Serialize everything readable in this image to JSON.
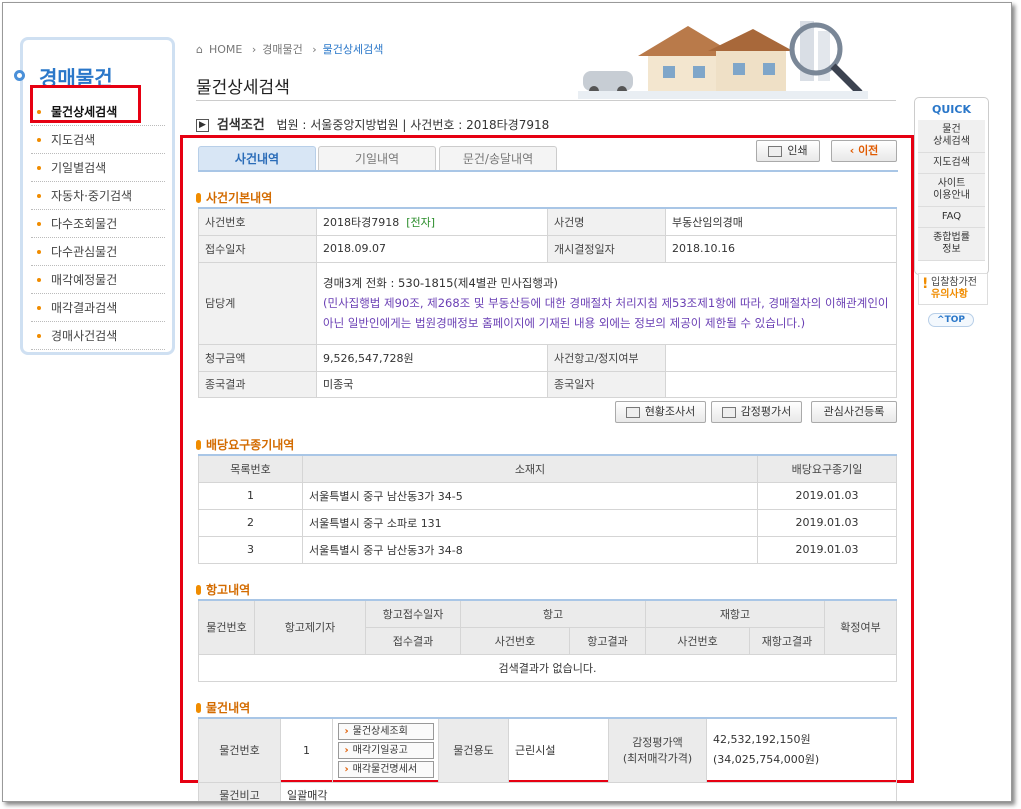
{
  "nav": {
    "title": "경매물건",
    "items": [
      "물건상세검색",
      "지도검색",
      "기일별검색",
      "자동차·중기검색",
      "다수조회물건",
      "다수관심물건",
      "매각예정물건",
      "매각결과검색",
      "경매사건검색"
    ]
  },
  "breadcrumb": {
    "home": "HOME",
    "level1": "경매물건",
    "current": "물건상세검색"
  },
  "page": {
    "title": "물건상세검색"
  },
  "search": {
    "label": "검색조건",
    "text": "법원 : 서울중앙지방법원 | 사건번호 : 2018타경7918"
  },
  "tabs": [
    "사건내역",
    "기일내역",
    "문건/송달내역"
  ],
  "actions": {
    "print": "인쇄",
    "prev": "이전"
  },
  "case_info": {
    "section": "사건기본내역",
    "case_no_label": "사건번호",
    "case_no": "2018타경7918",
    "e_tag": "[전자]",
    "case_name_label": "사건명",
    "case_name": "부동산임의경매",
    "received_label": "접수일자",
    "received": "2018.09.07",
    "start_label": "개시결정일자",
    "start": "2018.10.16",
    "dept_label": "담당계",
    "dept_line1": "경매3계    전화 : 530-1815(제4별관 민사집행과)",
    "dept_line2": "(민사집행법 제90조, 제268조 및 부동산등에 대한 경매절차 처리지침 제53조제1항에 따라, 경매절차의 이해관계인이 아닌 일반인에게는 법원경매정보 홈페이지에 기재된 내용 외에는 정보의 제공이 제한될 수 있습니다.)",
    "claim_label": "청구금액",
    "claim": "9,526,547,728원",
    "appeal_label": "사건항고/정지여부",
    "appeal": "",
    "result_label": "종국결과",
    "result": "미종국",
    "end_label": "종국일자",
    "end": ""
  },
  "doc_buttons": {
    "survey": "현황조사서",
    "appraisal": "감정평가서",
    "interest": "관심사건등록"
  },
  "dividend": {
    "section": "배당요구종기내역",
    "headers": [
      "목록번호",
      "소재지",
      "배당요구종기일"
    ],
    "rows": [
      [
        "1",
        "서울특별시 중구 남산동3가 34-5",
        "2019.01.03"
      ],
      [
        "2",
        "서울특별시 중구 소파로 131",
        "2019.01.03"
      ],
      [
        "3",
        "서울특별시 중구 남산동3가 34-8",
        "2019.01.03"
      ]
    ]
  },
  "appeal": {
    "section": "항고내역",
    "h_item": "물건번호",
    "h_appellant": "항고제기자",
    "h_date": "항고접수일자",
    "h_result0": "접수결과",
    "h_appeal": "항고",
    "h_caseno": "사건번호",
    "h_result": "항고결과",
    "h_reappeal": "재항고",
    "h_recaseno": "사건번호",
    "h_reresult": "재항고결과",
    "h_final": "확정여부",
    "empty": "검색결과가 없습니다."
  },
  "items": {
    "section": "물건내역",
    "no_label": "물건번호",
    "no": "1",
    "btn_detail": "물건상세조회",
    "btn_notice": "매각기일공고",
    "btn_spec": "매각물건명세서",
    "use_label": "물건용도",
    "use": "근린시설",
    "value_label": "감정평가액",
    "value_sub": "(최저매각가격)",
    "value": "42,532,192,150원",
    "min_price": "(34,025,754,000원)",
    "note_label": "물건비고",
    "note": "일괄매각"
  },
  "quick": {
    "title": "QUICK",
    "items": [
      "물건\n상세검색",
      "지도검색",
      "사이트\n이용안내",
      "FAQ",
      "종합법률\n정보"
    ],
    "notice1": "입찰참가전",
    "notice2": "유의사항",
    "top": "^TOP"
  }
}
